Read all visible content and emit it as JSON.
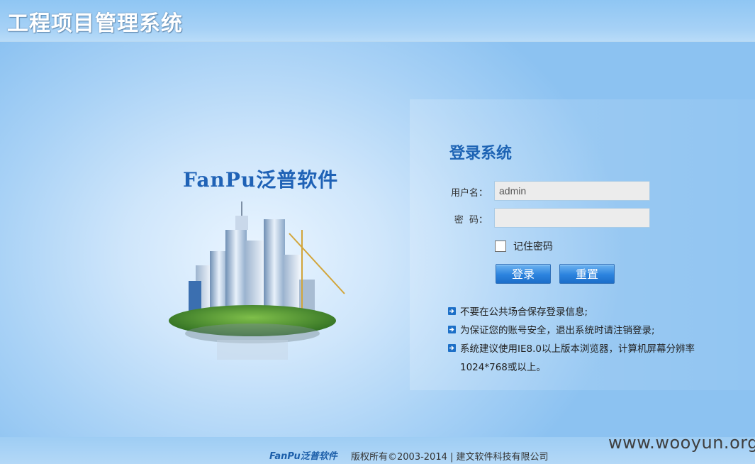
{
  "header": {
    "title": "工程项目管理系统"
  },
  "brand": {
    "name": "FanPu泛普软件"
  },
  "login": {
    "title": "登录系统",
    "username_label": "用户名：",
    "username_value": "admin",
    "password_label": "密  码：",
    "password_value": "",
    "remember_label": "记住密码",
    "remember_checked": false,
    "login_button": "登录",
    "reset_button": "重置"
  },
  "tips": [
    "不要在公共场合保存登录信息;",
    "为保证您的账号安全，退出系统时请注销登录;",
    "系统建议使用IE8.0以上版本浏览器，计算机屏幕分辨率1024*768或以上。"
  ],
  "footer": {
    "brand": "FanPu泛普软件",
    "copyright": "版权所有©2003-2014 | 建文软件科技有限公司"
  },
  "watermark": "www.wooyun.org",
  "colors": {
    "accent": "#1d63b4",
    "button": "#2c83de"
  }
}
